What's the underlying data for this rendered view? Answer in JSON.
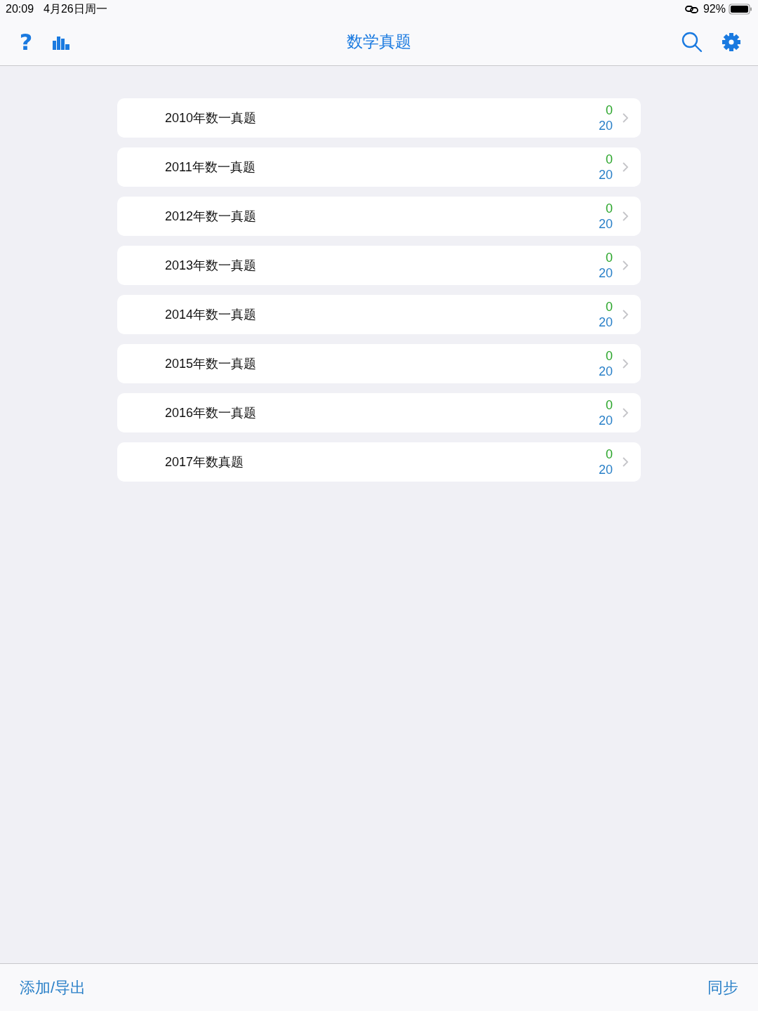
{
  "status_bar": {
    "time": "20:09",
    "date": "4月26日周一",
    "battery": "92%"
  },
  "nav_bar": {
    "help": "?",
    "title": "数学真题"
  },
  "items": [
    {
      "title": "2010年数一真题",
      "done": "0",
      "total": "20"
    },
    {
      "title": "2011年数一真题",
      "done": "0",
      "total": "20"
    },
    {
      "title": "2012年数一真题",
      "done": "0",
      "total": "20"
    },
    {
      "title": "2013年数一真题",
      "done": "0",
      "total": "20"
    },
    {
      "title": "2014年数一真题",
      "done": "0",
      "total": "20"
    },
    {
      "title": "2015年数一真题",
      "done": "0",
      "total": "20"
    },
    {
      "title": "2016年数一真题",
      "done": "0",
      "total": "20"
    },
    {
      "title": "2017年数真题",
      "done": "0",
      "total": "20"
    }
  ],
  "toolbar": {
    "left": "添加/导出",
    "right": "同步"
  }
}
